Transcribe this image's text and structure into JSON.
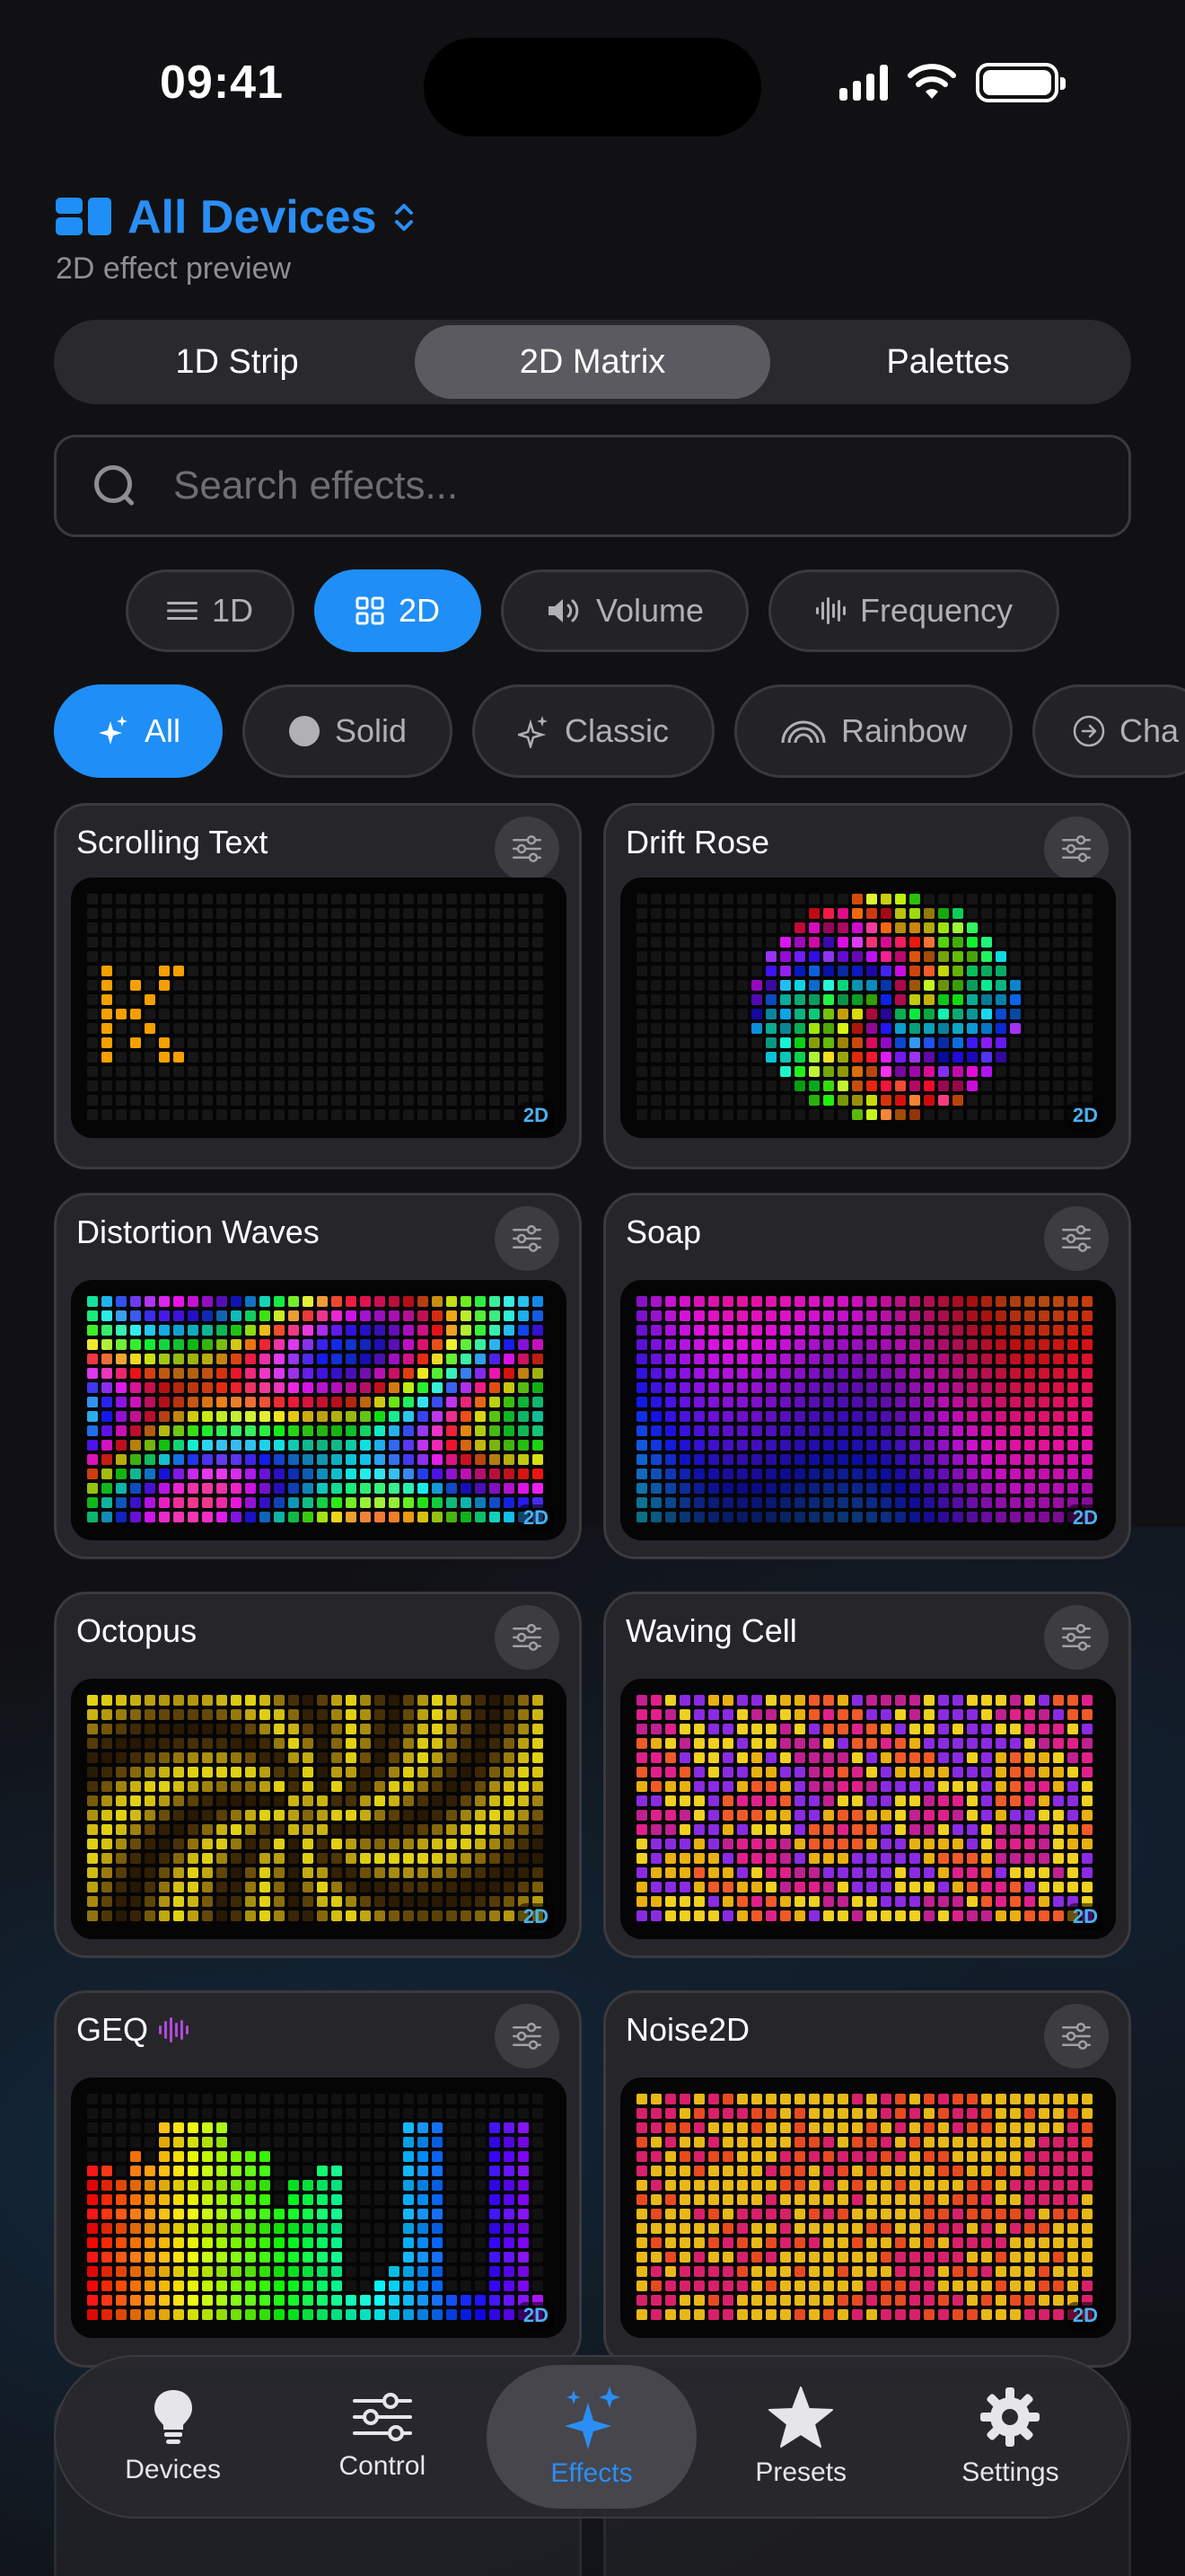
{
  "status": {
    "time": "09:41"
  },
  "header": {
    "title": "All Devices",
    "subtitle": "2D effect preview"
  },
  "segments": [
    {
      "label": "1D Strip",
      "active": false
    },
    {
      "label": "2D Matrix",
      "active": true
    },
    {
      "label": "Palettes",
      "active": false
    }
  ],
  "search": {
    "placeholder": "Search effects..."
  },
  "dimension_filters": [
    {
      "label": "1D",
      "icon": "lines-icon",
      "active": false
    },
    {
      "label": "2D",
      "icon": "grid-icon",
      "active": true
    },
    {
      "label": "Volume",
      "icon": "speaker-icon",
      "active": false
    },
    {
      "label": "Frequency",
      "icon": "waveform-icon",
      "active": false
    }
  ],
  "category_filters": [
    {
      "label": "All",
      "icon": "sparkles-icon",
      "active": true
    },
    {
      "label": "Solid",
      "icon": "circle-icon",
      "active": false
    },
    {
      "label": "Classic",
      "icon": "sparkle-icon",
      "active": false
    },
    {
      "label": "Rainbow",
      "icon": "rainbow-icon",
      "active": false
    },
    {
      "label": "Cha",
      "icon": "arrow-circle-icon",
      "active": false
    }
  ],
  "effects": [
    {
      "name": "Scrolling Text",
      "badge": "2D",
      "audio": false
    },
    {
      "name": "Drift Rose",
      "badge": "2D",
      "audio": false
    },
    {
      "name": "Distortion Waves",
      "badge": "2D",
      "audio": false
    },
    {
      "name": "Soap",
      "badge": "2D",
      "audio": false
    },
    {
      "name": "Octopus",
      "badge": "2D",
      "audio": false
    },
    {
      "name": "Waving Cell",
      "badge": "2D",
      "audio": false
    },
    {
      "name": "GEQ",
      "badge": "2D",
      "audio": true
    },
    {
      "name": "Noise2D",
      "badge": "2D",
      "audio": false
    }
  ],
  "tabs": [
    {
      "label": "Devices",
      "icon": "lightbulb-icon",
      "active": false
    },
    {
      "label": "Control",
      "icon": "sliders-icon",
      "active": false
    },
    {
      "label": "Effects",
      "icon": "sparkles-icon",
      "active": true
    },
    {
      "label": "Presets",
      "icon": "star-icon",
      "active": false
    },
    {
      "label": "Settings",
      "icon": "gear-icon",
      "active": false
    }
  ],
  "colors": {
    "accent": "#1f8ef7",
    "background": "#111114",
    "card": "#26262a"
  }
}
